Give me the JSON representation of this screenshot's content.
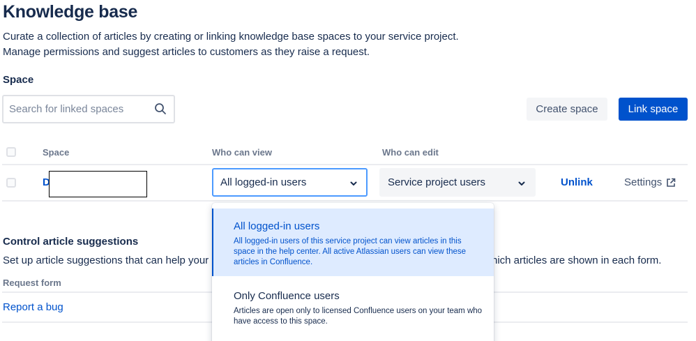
{
  "header": {
    "title": "Knowledge base",
    "description_line1": "Curate a collection of articles by creating or linking knowledge base spaces to your service project.",
    "description_line2": "Manage permissions and suggest articles to customers as they raise a request."
  },
  "space_section": {
    "label": "Space",
    "search_placeholder": "Search for linked spaces",
    "create_button": "Create space",
    "link_button": "Link space"
  },
  "table": {
    "headers": [
      "Space",
      "Who can view",
      "Who can edit"
    ],
    "row": {
      "space_name_visible": "D",
      "view_value": "All logged-in users",
      "edit_value": "Service project users",
      "unlink": "Unlink",
      "settings": "Settings"
    }
  },
  "suggestions": {
    "title": "Control article suggestions",
    "desc_left": "Set up article suggestions that can help your",
    "desc_right": "hich articles are shown in each form.",
    "column_header": "Request form",
    "rows": [
      "Report a bug"
    ]
  },
  "dropdown": {
    "options": [
      {
        "title": "All logged-in users",
        "description": "All logged-in users of this service project can view articles in this space in the help center. All active Atlassian users can view these articles in Confluence.",
        "selected": true
      },
      {
        "title": "Only Confluence users",
        "description": "Articles are open only to licensed Confluence users on your team who have access to this space.",
        "selected": false
      }
    ]
  },
  "colors": {
    "primary": "#0052CC",
    "text": "#172B4D",
    "muted": "#6B778C",
    "selected_bg": "#DEEBFF"
  }
}
